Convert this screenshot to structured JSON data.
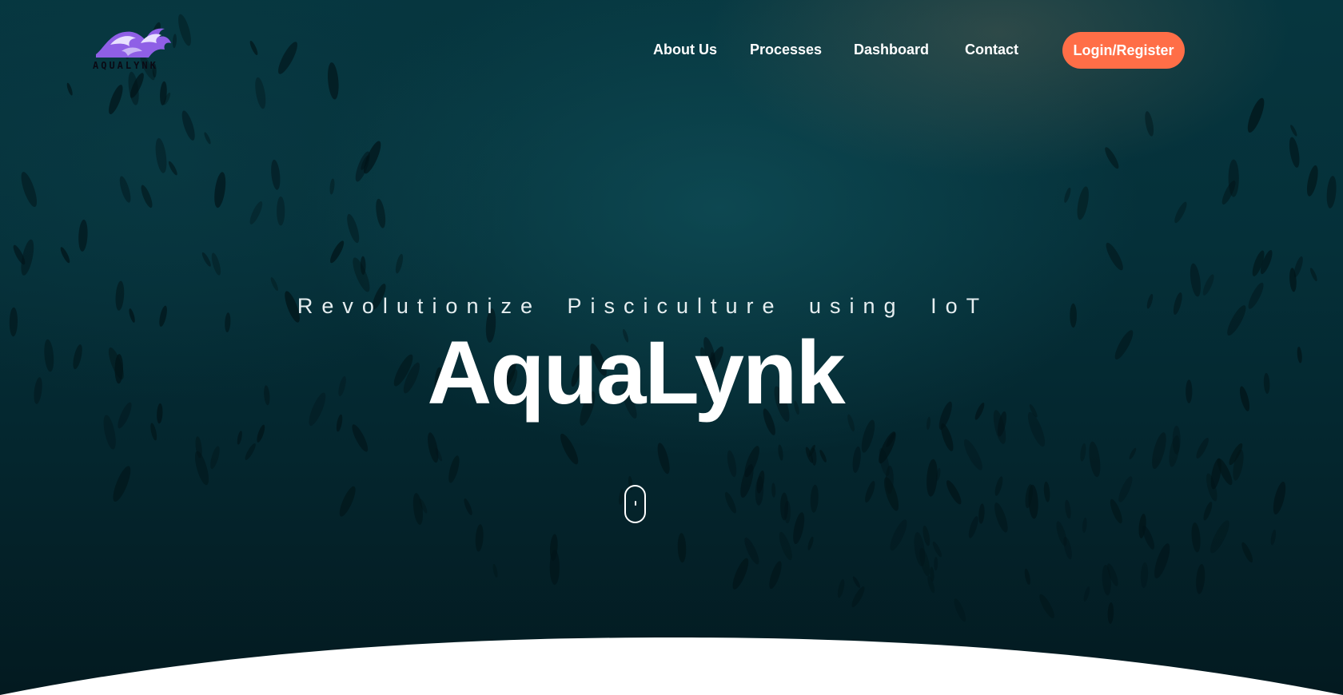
{
  "brand": {
    "logo_text": "AQUALYNK",
    "colors": {
      "logo_wave": "#8f5fe6",
      "logo_foam": "#e8e0ff"
    }
  },
  "nav": {
    "links": [
      {
        "label": "About Us"
      },
      {
        "label": "Processes"
      },
      {
        "label": "Dashboard"
      },
      {
        "label": "Contact"
      }
    ],
    "login_label": "Login/Register",
    "login_color": "#ff6e47"
  },
  "hero": {
    "tagline": "Revolutionize Pisciculture using IoT",
    "title": "AquaLynk",
    "scroll_indicator": "mouse-scroll-icon"
  }
}
